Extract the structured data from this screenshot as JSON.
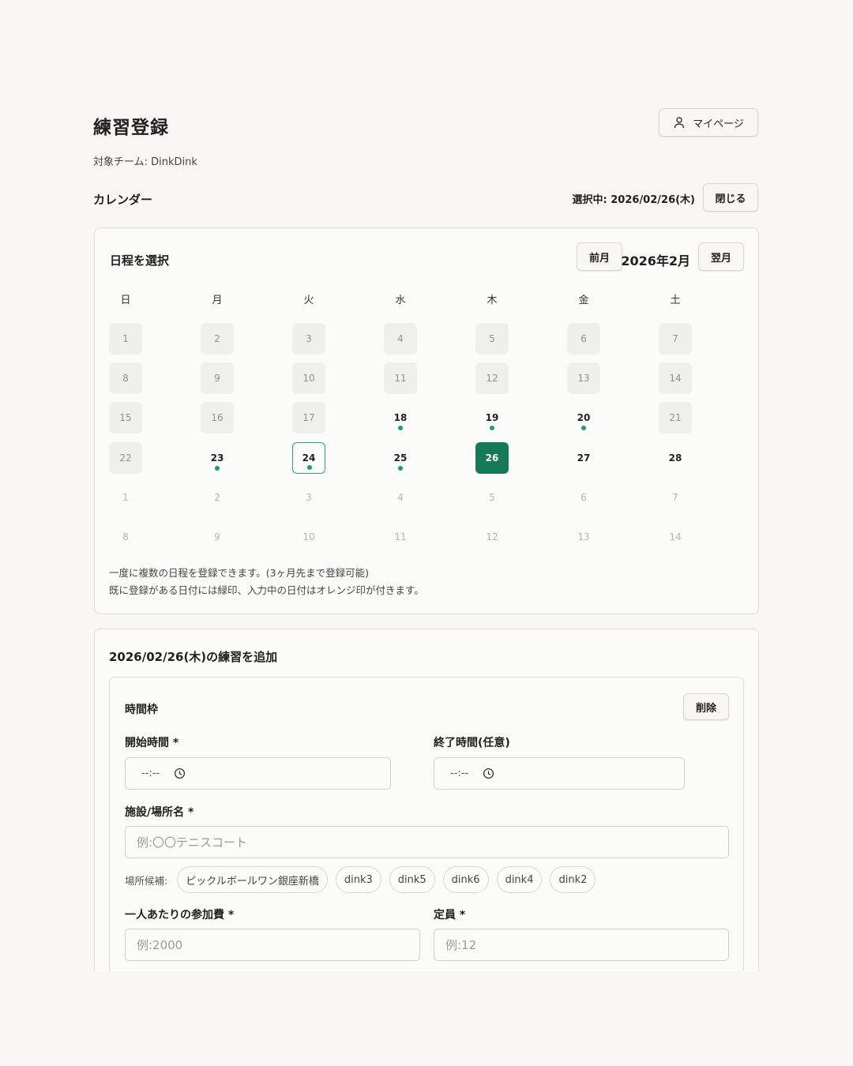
{
  "header": {
    "title": "練習登録",
    "mypage_label": "マイページ"
  },
  "team_label": "対象チーム: DinkDink",
  "calendar_section": {
    "heading": "カレンダー",
    "selected_info": "選択中: 2026/02/26(木)",
    "close_label": "閉じる"
  },
  "calendar": {
    "title": "日程を選択",
    "prev_label": "前月",
    "month_label": "2026年2月",
    "next_label": "翌月",
    "weekdays": [
      "日",
      "月",
      "火",
      "水",
      "木",
      "金",
      "土"
    ],
    "days": [
      {
        "label": "1",
        "state": "past"
      },
      {
        "label": "2",
        "state": "past"
      },
      {
        "label": "3",
        "state": "past"
      },
      {
        "label": "4",
        "state": "past"
      },
      {
        "label": "5",
        "state": "past"
      },
      {
        "label": "6",
        "state": "past"
      },
      {
        "label": "7",
        "state": "past"
      },
      {
        "label": "8",
        "state": "past"
      },
      {
        "label": "9",
        "state": "past"
      },
      {
        "label": "10",
        "state": "past"
      },
      {
        "label": "11",
        "state": "past"
      },
      {
        "label": "12",
        "state": "past"
      },
      {
        "label": "13",
        "state": "past"
      },
      {
        "label": "14",
        "state": "past"
      },
      {
        "label": "15",
        "state": "past"
      },
      {
        "label": "16",
        "state": "past"
      },
      {
        "label": "17",
        "state": "past"
      },
      {
        "label": "18",
        "state": "active",
        "dot": true
      },
      {
        "label": "19",
        "state": "active",
        "dot": true
      },
      {
        "label": "20",
        "state": "active",
        "dot": true
      },
      {
        "label": "21",
        "state": "past"
      },
      {
        "label": "22",
        "state": "past"
      },
      {
        "label": "23",
        "state": "active",
        "dot": true
      },
      {
        "label": "24",
        "state": "today",
        "dot": true
      },
      {
        "label": "25",
        "state": "active",
        "dot": true
      },
      {
        "label": "26",
        "state": "selected"
      },
      {
        "label": "27",
        "state": "active"
      },
      {
        "label": "28",
        "state": "active"
      },
      {
        "label": "1",
        "state": "next"
      },
      {
        "label": "2",
        "state": "next"
      },
      {
        "label": "3",
        "state": "next"
      },
      {
        "label": "4",
        "state": "next"
      },
      {
        "label": "5",
        "state": "next"
      },
      {
        "label": "6",
        "state": "next"
      },
      {
        "label": "7",
        "state": "next"
      },
      {
        "label": "8",
        "state": "next"
      },
      {
        "label": "9",
        "state": "next"
      },
      {
        "label": "10",
        "state": "next"
      },
      {
        "label": "11",
        "state": "next"
      },
      {
        "label": "12",
        "state": "next"
      },
      {
        "label": "13",
        "state": "next"
      },
      {
        "label": "14",
        "state": "next"
      }
    ],
    "note_line1": "一度に複数の日程を登録できます。(3ヶ月先まで登録可能)",
    "note_line2": "既に登録がある日付には緑印、入力中の日付はオレンジ印が付きます。",
    "colors": {
      "selected": "#167a58",
      "dot": "#16a06e"
    }
  },
  "add_section": {
    "title": "2026/02/26(木)の練習を追加",
    "slot": {
      "title": "時間枠",
      "delete_label": "削除",
      "start_label": "開始時間 *",
      "start_value": "--:--",
      "end_label": "終了時間(任意)",
      "end_value": "--:--",
      "venue_label": "施設/場所名 *",
      "venue_placeholder": "例:〇〇テニスコート",
      "candidates_label": "場所候補:",
      "candidates": [
        "ピックルボールワン銀座新橋",
        "dink3",
        "dink5",
        "dink6",
        "dink4",
        "dink2"
      ],
      "fee_label": "一人あたりの参加費 *",
      "fee_placeholder": "例:2000",
      "capacity_label": "定員 *",
      "capacity_placeholder": "例:12"
    }
  }
}
